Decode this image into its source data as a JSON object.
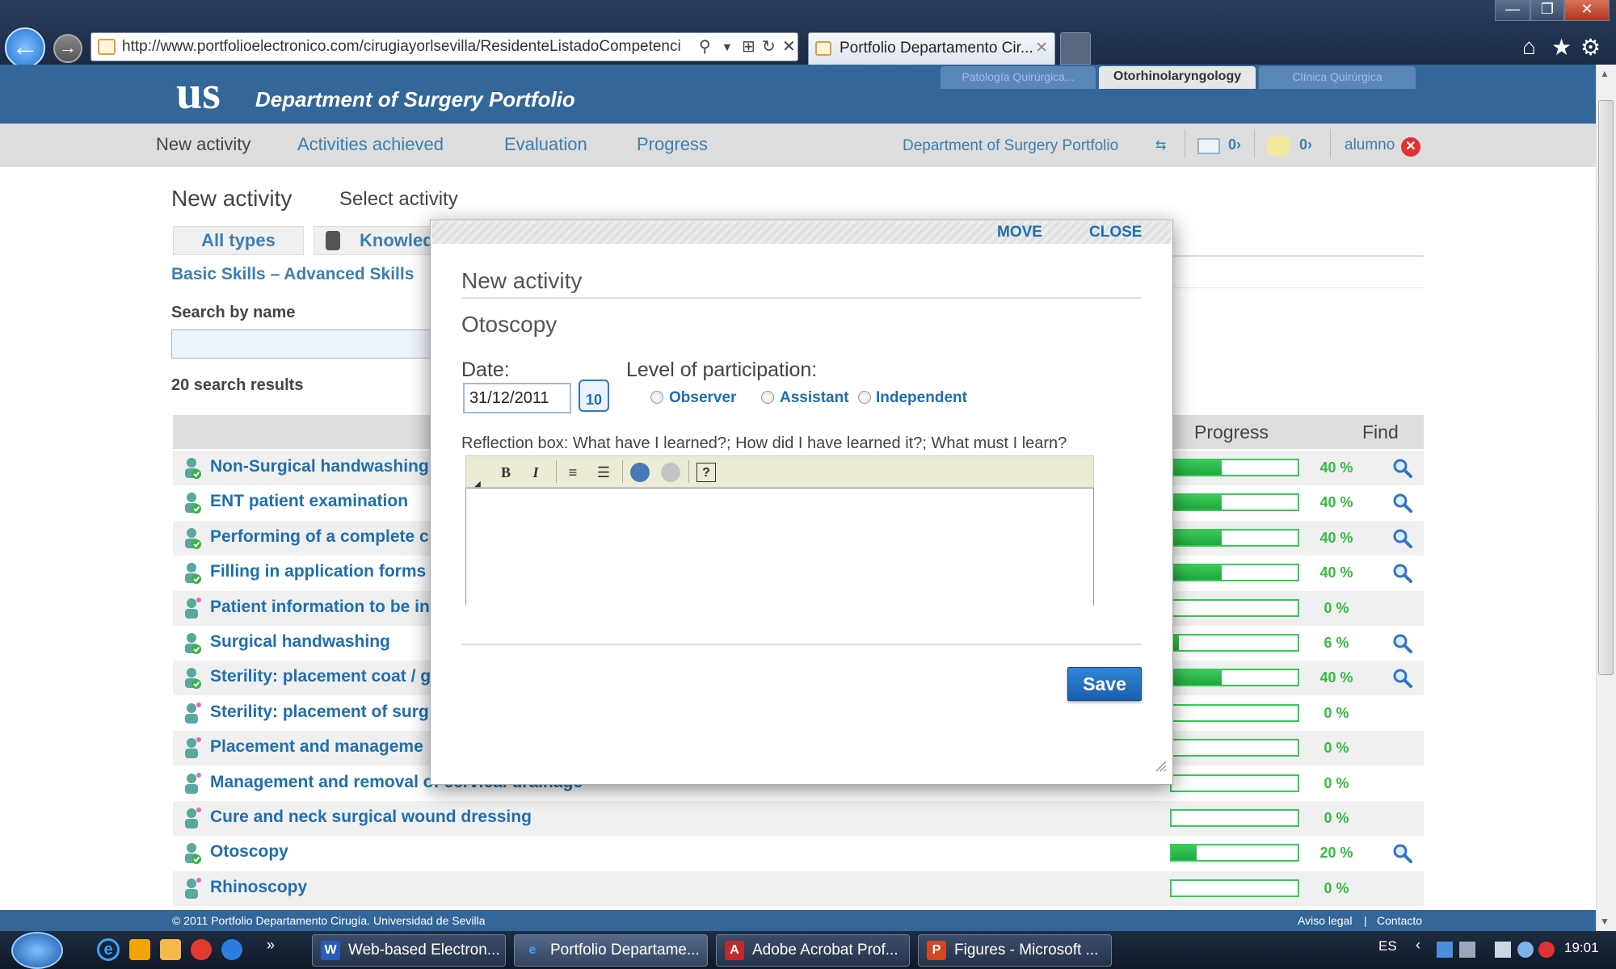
{
  "browser": {
    "url": "http://www.portfolioelectronico.com/cirugiayorlsevilla/ResidenteListadoCompetenci",
    "tab_title": "Portfolio Departamento Cir...",
    "min": "—",
    "max": "❐",
    "close": "✕"
  },
  "site": {
    "logo": "us",
    "title": "Department of Surgery Portfolio",
    "tabs": [
      "Patología Quirúrgica...",
      "Otorhinolaryngology",
      "Clínica Quirúrgica"
    ]
  },
  "nav": {
    "new_activity": "New activity",
    "achieved": "Activities achieved",
    "evaluation": "Evaluation",
    "progress": "Progress",
    "portfolio_link": "Department of Surgery Portfolio",
    "mail_count": "0›",
    "notes_count": "0›",
    "user": "alumno"
  },
  "page": {
    "title": "New activity",
    "subtitle": "Select activity",
    "type_all": "All types",
    "type_knowledge": "Knowled",
    "skills": "Basic Skills – Advanced Skills",
    "search_label": "Search by name",
    "results": "20 search results",
    "col_progress": "Progress",
    "col_find": "Find"
  },
  "rows": [
    {
      "label": "Non-Surgical handwashing",
      "pct": 40,
      "pct_text": "40 %",
      "find": true,
      "alt": true,
      "tick": true
    },
    {
      "label": "ENT patient examination",
      "pct": 40,
      "pct_text": "40 %",
      "find": true,
      "alt": false,
      "tick": true
    },
    {
      "label": "Performing of a complete c",
      "pct": 40,
      "pct_text": "40 %",
      "find": true,
      "alt": true,
      "tick": true
    },
    {
      "label": "Filling in application forms",
      "pct": 40,
      "pct_text": "40 %",
      "find": true,
      "alt": false,
      "tick": true
    },
    {
      "label": "Patient information to be in",
      "pct": 0,
      "pct_text": "0 %",
      "find": false,
      "alt": true,
      "tick": false
    },
    {
      "label": "Surgical handwashing",
      "pct": 6,
      "pct_text": "6 %",
      "find": true,
      "alt": false,
      "tick": true
    },
    {
      "label": "Sterility: placement coat / g",
      "pct": 40,
      "pct_text": "40 %",
      "find": true,
      "alt": true,
      "tick": true
    },
    {
      "label": "Sterility: placement of surg",
      "pct": 0,
      "pct_text": "0 %",
      "find": false,
      "alt": false,
      "tick": false
    },
    {
      "label": "Placement and manageme",
      "pct": 0,
      "pct_text": "0 %",
      "find": false,
      "alt": true,
      "tick": false
    },
    {
      "label": "Management and removal of cervical drainage",
      "pct": 0,
      "pct_text": "0 %",
      "find": false,
      "alt": false,
      "tick": false
    },
    {
      "label": "Cure and neck surgical wound dressing",
      "pct": 0,
      "pct_text": "0 %",
      "find": false,
      "alt": true,
      "tick": false
    },
    {
      "label": "Otoscopy",
      "pct": 20,
      "pct_text": "20 %",
      "find": true,
      "alt": false,
      "tick": true
    },
    {
      "label": "Rhinoscopy",
      "pct": 0,
      "pct_text": "0 %",
      "find": false,
      "alt": true,
      "tick": false
    }
  ],
  "footer": {
    "copyright": "© 2011 Portfolio Departamento Cirugía. Universidad de Sevilla",
    "legal": "Aviso legal",
    "sep": "|",
    "contact": "Contacto"
  },
  "dialog": {
    "move": "MOVE",
    "close": "CLOSE",
    "title": "New activity",
    "activity": "Otoscopy",
    "date_label": "Date:",
    "date_value": "31/12/2011",
    "calendar_day": "10",
    "level_label": "Level of participation:",
    "levels": [
      "Observer",
      "Assistant",
      "Independent"
    ],
    "reflection_label": "Reflection box: What have I learned?; How did I have learned it?; What must I learn?",
    "bold": "B",
    "italic": "I",
    "save": "Save"
  },
  "taskbar": {
    "tasks": [
      "Web-based Electron...",
      "Portfolio Departame...",
      "Adobe Acrobat Prof...",
      "Figures - Microsoft ..."
    ],
    "task_icons": [
      "W",
      "e",
      "A",
      "P"
    ],
    "lang": "ES",
    "time": "19:01"
  },
  "colors": {
    "header": "#336699",
    "link": "#1f6fae",
    "progress": "#33cc55",
    "save": "#1c5fae"
  }
}
